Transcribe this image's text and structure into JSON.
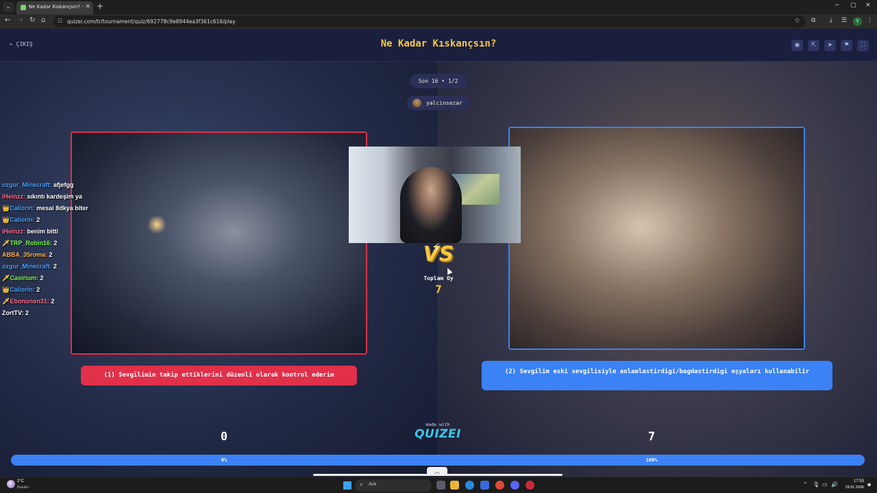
{
  "browser": {
    "tab_title": "Ne Kadar Kıskançsın? - Tier Lis",
    "url": "quizei.com/tr/tournament/quiz/692778c9e8944ea3f361c616/play"
  },
  "header": {
    "exit_label": "ÇIKIŞ",
    "title": "Ne Kadar Kıskançsın?"
  },
  "round": {
    "label": "Son 16 • 1/2"
  },
  "user": {
    "name": "yalcinsezar"
  },
  "vs": {
    "text": "VS",
    "total_label": "Toplam Oy",
    "total_value": "7"
  },
  "options": {
    "left": {
      "text": "(1) Sevgilimin takip ettiklerini düzenli olarak kontrol ederim",
      "votes": "0",
      "percent": "0%"
    },
    "right": {
      "text": "(2) Sevgilim eski sevgilisiyle anlamlastirdigi/bagdastirdigi eşyaları kullanabilir",
      "votes": "7",
      "percent": "100%"
    }
  },
  "progress": {
    "right_fraction": 1.0
  },
  "branding": {
    "made_with": "made with",
    "logo": "QUIZEI"
  },
  "chat": [
    {
      "user": "ozgur_Minecraft:",
      "msg": "afjefgg",
      "color": "#4aa3ff",
      "badge": ""
    },
    {
      "user": "iHeinzz:",
      "msg": "sıkıntı kardeşim ya",
      "color": "#ff6b8a",
      "badge": ""
    },
    {
      "user": "Caliorin:",
      "msg": "mesai 8dkya biter",
      "color": "#4aa3ff",
      "badge": "👑"
    },
    {
      "user": "Caliorin:",
      "msg": "2",
      "color": "#4aa3ff",
      "badge": "👑"
    },
    {
      "user": "iHeinzz:",
      "msg": "benim bitti",
      "color": "#ff6b8a",
      "badge": ""
    },
    {
      "user": "TRP_Robin16:",
      "msg": "2",
      "color": "#7cff4a",
      "badge": "🗡"
    },
    {
      "user": "ABBA_35roma:",
      "msg": "2",
      "color": "#ffb347",
      "badge": ""
    },
    {
      "user": "ozgur_Minecraft:",
      "msg": "2",
      "color": "#4aa3ff",
      "badge": ""
    },
    {
      "user": "Casirium:",
      "msg": "2",
      "color": "#7cff4a",
      "badge": "🗡"
    },
    {
      "user": "Caliorin:",
      "msg": "2",
      "color": "#4aa3ff",
      "badge": "👑"
    },
    {
      "user": "Ebonunon31:",
      "msg": "2",
      "color": "#ff6b8a",
      "badge": "🗡"
    },
    {
      "user": "ZortTV:",
      "msg": "2",
      "color": "#ffffff",
      "badge": ""
    }
  ],
  "taskbar": {
    "weather_temp": "2°C",
    "weather_desc": "Bulutlu",
    "search_placeholder": "Ara",
    "time": "17:53",
    "date": "19.01.2026"
  },
  "colors": {
    "accent_red": "#e0304a",
    "accent_blue": "#3b82f6",
    "title_yellow": "#f5c842"
  }
}
